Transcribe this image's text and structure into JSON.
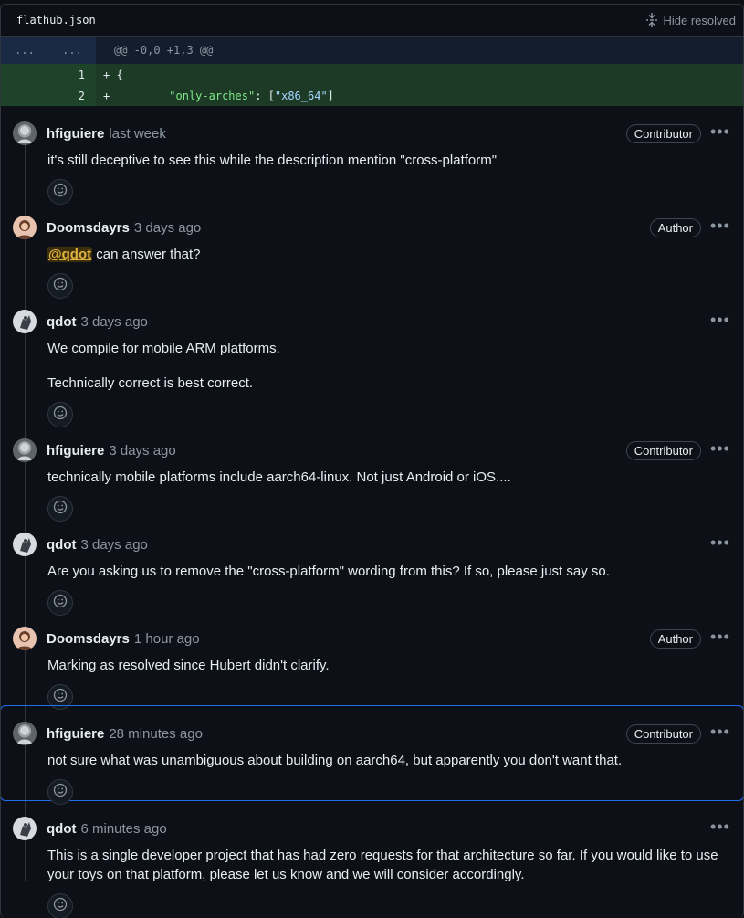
{
  "file": {
    "name": "flathub.json",
    "hide_resolved": "Hide resolved"
  },
  "diff": {
    "hunk": {
      "left": "...",
      "right": "...",
      "text": "@@ -0,0 +1,3 @@"
    },
    "lines": [
      {
        "num": "1",
        "sign": "+",
        "code": "{"
      },
      {
        "num": "2",
        "sign": "+",
        "key": "\"only-arches\"",
        "rest": ": [",
        "value": "\"x86_64\"",
        "close": "]"
      }
    ]
  },
  "comments": [
    {
      "author": "hfiguiere",
      "time": "last week",
      "badge": "Contributor",
      "avatar": "hfiguiere-avatar",
      "text": [
        "it's still deceptive to see this while the description mention \"cross-platform\""
      ]
    },
    {
      "author": "Doomsdayrs",
      "time": "3 days ago",
      "badge": "Author",
      "avatar": "doomsdayrs-avatar",
      "mention": "@qdot",
      "text": [
        " can answer that?"
      ]
    },
    {
      "author": "qdot",
      "time": "3 days ago",
      "badge": "",
      "avatar": "qdot-avatar",
      "text": [
        "We compile for mobile ARM platforms.",
        "Technically correct is best correct."
      ]
    },
    {
      "author": "hfiguiere",
      "time": "3 days ago",
      "badge": "Contributor",
      "avatar": "hfiguiere-avatar",
      "text": [
        "technically mobile platforms include aarch64-linux. Not just Android or iOS...."
      ]
    },
    {
      "author": "qdot",
      "time": "3 days ago",
      "badge": "",
      "avatar": "qdot-avatar",
      "text": [
        "Are you asking us to remove the \"cross-platform\" wording from this? If so, please just say so."
      ]
    },
    {
      "author": "Doomsdayrs",
      "time": "1 hour ago",
      "badge": "Author",
      "avatar": "doomsdayrs-avatar",
      "text": [
        "Marking as resolved since Hubert didn't clarify."
      ]
    },
    {
      "author": "hfiguiere",
      "time": "28 minutes ago",
      "badge": "Contributor",
      "avatar": "hfiguiere-avatar",
      "text": [
        "not sure what was unambiguous about building on aarch64, but apparently you don't want that."
      ]
    },
    {
      "author": "qdot",
      "time": "6 minutes ago",
      "badge": "",
      "avatar": "qdot-avatar",
      "text": [
        "This is a single developer project that has had zero requests for that architecture so far. If you would like to use your toys on that platform, please let us know and we will consider accordingly."
      ]
    }
  ],
  "icons": {
    "more": "kebab-horizontal-icon",
    "reaction": "smiley-icon",
    "unfold": "unfold-icon"
  },
  "colors": {
    "highlight_border": "#1f6feb",
    "mention": "#e3b341",
    "added_bg": "#1c3a26"
  }
}
